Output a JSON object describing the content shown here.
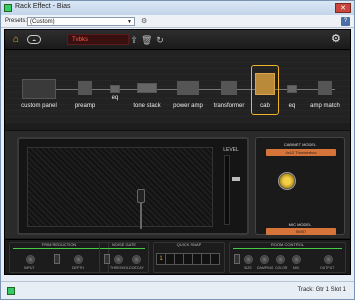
{
  "window": {
    "title": "Rack Effect - Bias",
    "close": "✕"
  },
  "presets": {
    "label": "Presets:",
    "value": "(Custom)",
    "help": "?"
  },
  "topbar": {
    "preset_name": "Tvbks",
    "cloud": "☁"
  },
  "chain": {
    "modules": [
      {
        "label": "custom panel"
      },
      {
        "label": "preamp"
      },
      {
        "label": "eq"
      },
      {
        "label": "tone stack"
      },
      {
        "label": "power amp"
      },
      {
        "label": "transformer"
      },
      {
        "label": "cab"
      },
      {
        "label": "eq"
      },
      {
        "label": "amp match"
      }
    ]
  },
  "cab_panel": {
    "cabinet_model_label": "CABINET MODEL",
    "cabinet_model_value": "4x12 Thunderbox",
    "mic_model_label": "MIC MODEL",
    "mic_model_value": "SM57"
  },
  "level": {
    "label": "LEVEL"
  },
  "bottom": {
    "noise_reduction": {
      "title": "FRIM REDUCTION",
      "knob1": "INPUT",
      "knob2": "DEPTH"
    },
    "noise_gate": {
      "title": "NOISE GATE",
      "knob1": "THRESHOLD",
      "knob2": "DECAY"
    },
    "quick_snap": {
      "title": "QUICK SNAP",
      "slots": [
        "1",
        "",
        "",
        "",
        "",
        "",
        "",
        ""
      ]
    },
    "room_control": {
      "title": "ROOM CONTROL",
      "knobs": [
        "SIZE",
        "DAMPING",
        "COLOR",
        "MIX"
      ],
      "output": "OUTPUT"
    }
  },
  "status": {
    "track": "Track: Gtr 1",
    "slot": "Slot 1"
  },
  "colors": {
    "accent": "#f0b428",
    "preset_name": "#ff5b4a",
    "cab_select": "#d7743a"
  },
  "icons": [
    "home-icon",
    "cloud-icon",
    "export-icon",
    "delete-icon",
    "redo-icon",
    "gear-icon"
  ]
}
